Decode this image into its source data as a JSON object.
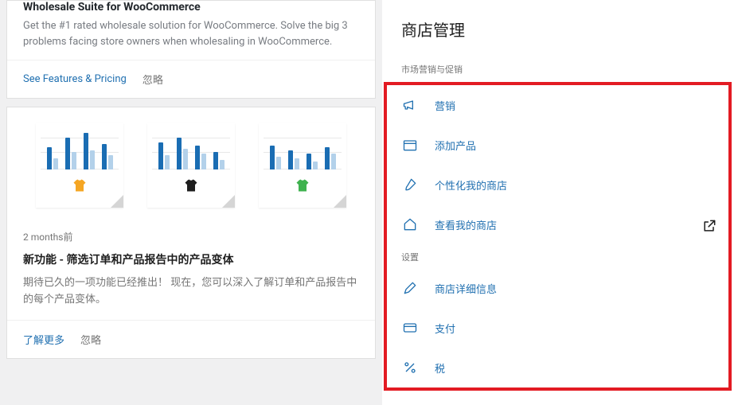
{
  "colors": {
    "link": "#2271b1",
    "highlight": "#e31b23"
  },
  "left": {
    "card1": {
      "title": "Wholesale Suite for WooCommerce",
      "desc": "Get the #1 rated wholesale solution for WooCommerce. Solve the big 3 problems facing store owners when wholesaling in WooCommerce.",
      "cta": "See Features & Pricing",
      "dismiss": "忽略"
    },
    "card2": {
      "charts": [
        {
          "shirt": "#f5a623",
          "bars": [
            [
              28,
              14
            ],
            [
              40,
              22
            ],
            [
              46,
              24
            ],
            [
              32,
              18
            ]
          ]
        },
        {
          "shirt": "#1e1e1e",
          "bars": [
            [
              34,
              18
            ],
            [
              40,
              26
            ],
            [
              30,
              20
            ],
            [
              22,
              12
            ]
          ]
        },
        {
          "shirt": "#3fb24f",
          "bars": [
            [
              30,
              16
            ],
            [
              24,
              14
            ],
            [
              20,
              10
            ],
            [
              28,
              20
            ]
          ]
        }
      ],
      "time": "2 months前",
      "title": "新功能 - 筛选订单和产品报告中的产品变体",
      "desc": "期待已久的一项功能已经推出！ 现在，您可以深入了解订单和产品报告中的每个产品变体。",
      "more": "了解更多",
      "dismiss": "忽略"
    }
  },
  "right": {
    "header": "商店管理",
    "section_marketing": "市场营销与促销",
    "section_settings": "设置",
    "items_marketing": [
      {
        "icon": "megaphone",
        "label": "营销"
      },
      {
        "icon": "add-product",
        "label": "添加产品"
      },
      {
        "icon": "brush",
        "label": "个性化我的商店"
      },
      {
        "icon": "home",
        "label": "查看我的商店",
        "external": true
      }
    ],
    "items_settings": [
      {
        "icon": "pencil",
        "label": "商店详细信息"
      },
      {
        "icon": "card",
        "label": "支付"
      },
      {
        "icon": "percent",
        "label": "税"
      }
    ]
  }
}
